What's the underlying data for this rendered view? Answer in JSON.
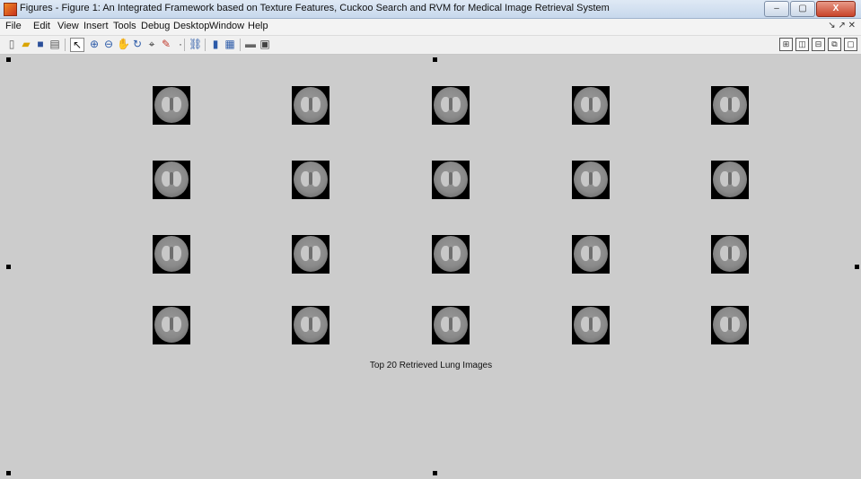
{
  "window": {
    "title": "Figures - Figure 1: An Integrated Framework based on Texture Features, Cuckoo Search and RVM for Medical Image Retrieval System",
    "minimize": "–",
    "maximize": "▢",
    "close": "X"
  },
  "menu": [
    "File",
    "Edit",
    "View",
    "Insert",
    "Tools",
    "Debug",
    "Desktop",
    "Window",
    "Help"
  ],
  "dock_controls": "↘ ↗ ✕",
  "toolbar_icons": [
    "new-figure-icon",
    "open-icon",
    "save-icon",
    "print-icon",
    "edit-plot-icon",
    "zoom-in-icon",
    "zoom-out-icon",
    "pan-icon",
    "rotate-icon",
    "data-cursor-icon",
    "brush-icon",
    "link-icon",
    "colorbar-icon",
    "legend-icon",
    "hide-plot-tools-icon",
    "show-plot-tools-icon"
  ],
  "layout_icons": [
    "tile-icon",
    "left-right-icon",
    "top-bottom-icon",
    "float-icon",
    "maximize-icon"
  ],
  "figure": {
    "caption": "Top 20 Retrieved Lung Images",
    "rows": 4,
    "cols": 5,
    "image_count": 20
  }
}
